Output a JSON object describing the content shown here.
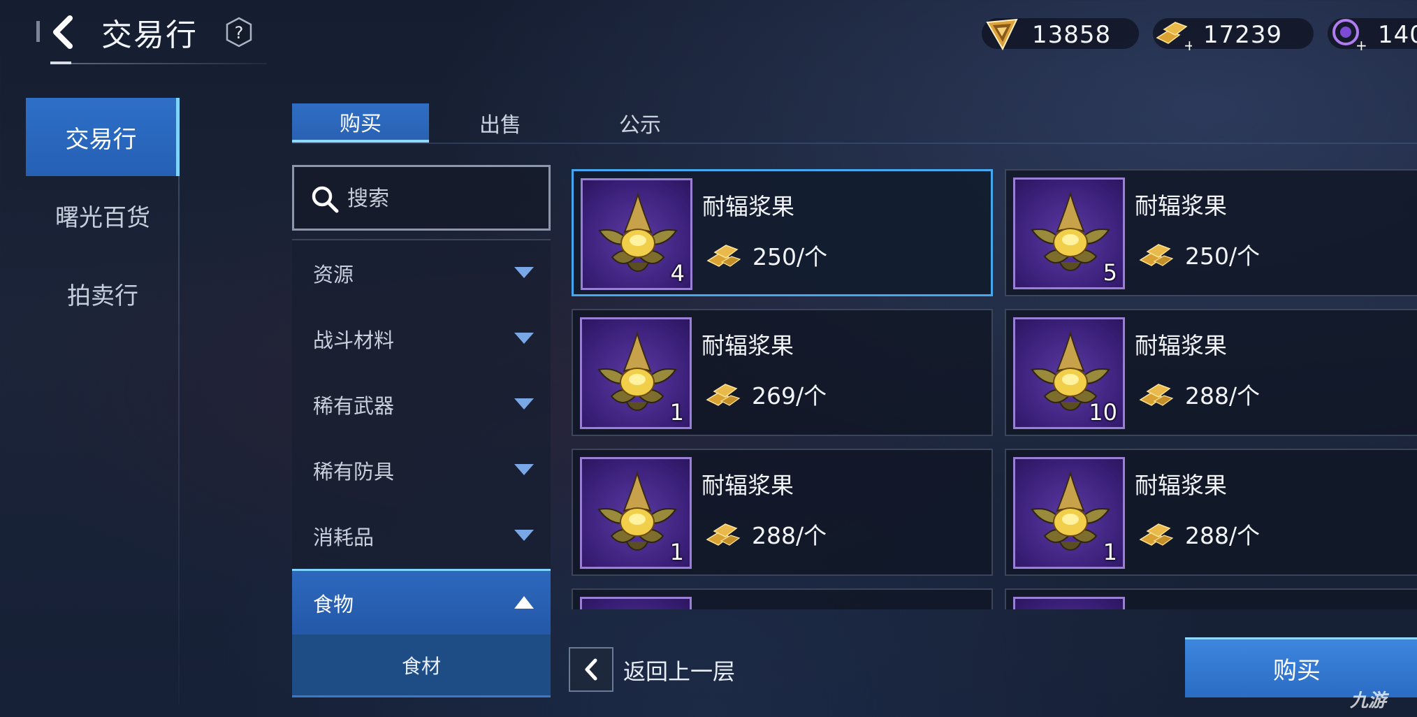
{
  "header": {
    "title": "交易行",
    "help_symbol": "?"
  },
  "currencies": [
    {
      "icon": "triangle-crystal-icon",
      "value": "13858"
    },
    {
      "icon": "gold-bars-icon",
      "value": "17239"
    },
    {
      "icon": "purple-orb-icon",
      "value": "140"
    }
  ],
  "left_nav": {
    "items": [
      {
        "label": "交易行",
        "active": true
      },
      {
        "label": "曙光百货",
        "active": false
      },
      {
        "label": "拍卖行",
        "active": false
      }
    ]
  },
  "tabs": [
    {
      "label": "购买",
      "active": true
    },
    {
      "label": "出售",
      "active": false
    },
    {
      "label": "公示",
      "active": false
    }
  ],
  "search": {
    "placeholder": "搜索"
  },
  "categories": [
    {
      "label": "资源",
      "expanded": false
    },
    {
      "label": "战斗材料",
      "expanded": false
    },
    {
      "label": "稀有武器",
      "expanded": false
    },
    {
      "label": "稀有防具",
      "expanded": false
    },
    {
      "label": "消耗品",
      "expanded": false
    },
    {
      "label": "食物",
      "expanded": true
    }
  ],
  "subcategory": {
    "label": "食材"
  },
  "listings": [
    {
      "name": "耐辐浆果",
      "qty": "4",
      "price": "250/个",
      "selected": true
    },
    {
      "name": "耐辐浆果",
      "qty": "5",
      "price": "250/个",
      "selected": false
    },
    {
      "name": "耐辐浆果",
      "qty": "1",
      "price": "269/个",
      "selected": false
    },
    {
      "name": "耐辐浆果",
      "qty": "10",
      "price": "288/个",
      "selected": false
    },
    {
      "name": "耐辐浆果",
      "qty": "1",
      "price": "288/个",
      "selected": false
    },
    {
      "name": "耐辐浆果",
      "qty": "1",
      "price": "288/个",
      "selected": false
    }
  ],
  "bottom": {
    "back_label": "返回上一层",
    "buy_label": "购买"
  },
  "watermark": "九游",
  "colors": {
    "accent_blue": "#2e6fc8",
    "highlight_cyan": "#7fd3ff",
    "item_rarity_purple": "#3a1f78"
  }
}
